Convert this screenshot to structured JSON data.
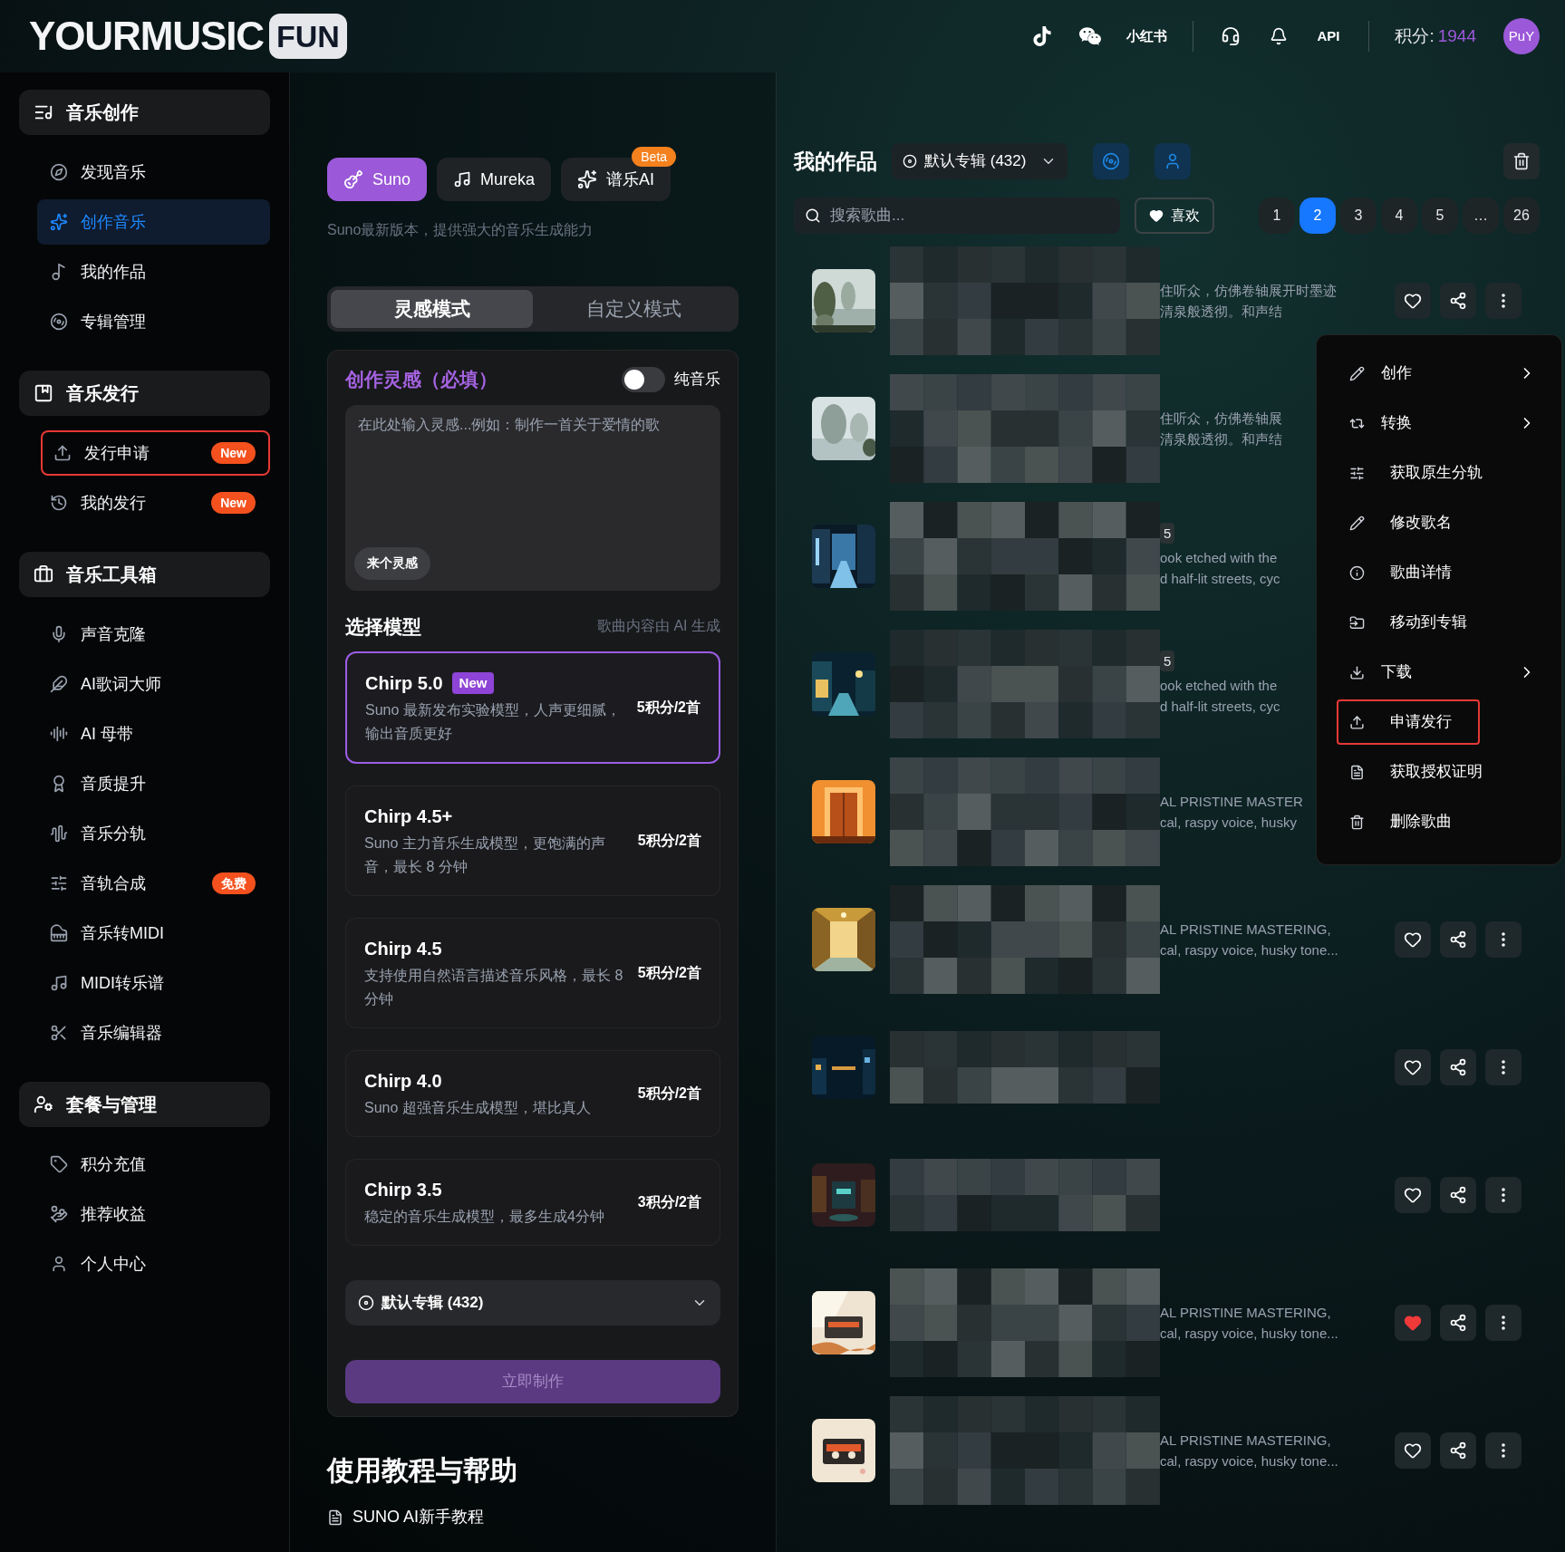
{
  "header": {
    "logo": "YOURMUSIC",
    "logo_badge": "FUN",
    "xiaohongshu": "小红书",
    "api": "API",
    "points_label": "积分:",
    "points": "1944",
    "avatar": "PuY"
  },
  "sidebar": {
    "sections": [
      {
        "title": "音乐创作",
        "items": [
          {
            "label": "发现音乐",
            "selected": false,
            "highlighted": false
          },
          {
            "label": "创作音乐",
            "selected": true,
            "highlighted": false
          },
          {
            "label": "我的作品",
            "selected": false,
            "highlighted": false
          },
          {
            "label": "专辑管理",
            "selected": false,
            "highlighted": false
          }
        ]
      },
      {
        "title": "音乐发行",
        "items": [
          {
            "label": "发行申请",
            "selected": false,
            "highlighted": true,
            "badge": "New"
          },
          {
            "label": "我的发行",
            "selected": false,
            "highlighted": false,
            "badge": "New"
          }
        ]
      },
      {
        "title": "音乐工具箱",
        "items": [
          {
            "label": "声音克隆",
            "selected": false,
            "highlighted": false
          },
          {
            "label": "AI歌词大师",
            "selected": false,
            "highlighted": false
          },
          {
            "label": "AI 母带",
            "selected": false,
            "highlighted": false
          },
          {
            "label": "音质提升",
            "selected": false,
            "highlighted": false
          },
          {
            "label": "音乐分轨",
            "selected": false,
            "highlighted": false
          },
          {
            "label": "音轨合成",
            "selected": false,
            "highlighted": false,
            "badge": "免费"
          },
          {
            "label": "音乐转MIDI",
            "selected": false,
            "highlighted": false
          },
          {
            "label": "MIDI转乐谱",
            "selected": false,
            "highlighted": false
          },
          {
            "label": "音乐编辑器",
            "selected": false,
            "highlighted": false
          }
        ]
      },
      {
        "title": "套餐与管理",
        "items": [
          {
            "label": "积分充值",
            "selected": false,
            "highlighted": false
          },
          {
            "label": "推荐收益",
            "selected": false,
            "highlighted": false
          },
          {
            "label": "个人中心",
            "selected": false,
            "highlighted": false
          }
        ]
      }
    ]
  },
  "create": {
    "engines": [
      {
        "label": "Suno",
        "selected": true
      },
      {
        "label": "Mureka",
        "selected": false
      },
      {
        "label": "谱乐AI",
        "selected": false,
        "badge": "Beta"
      }
    ],
    "engine_note": "Suno最新版本，提供强大的音乐生成能力",
    "modes": [
      {
        "label": "灵感模式",
        "selected": true
      },
      {
        "label": "自定义模式",
        "selected": false
      }
    ],
    "inspiration": {
      "title": "创作灵感（必填）",
      "instrumental_label": "纯音乐",
      "instrumental_on": false,
      "placeholder": "在此处输入灵感...例如：制作一首关于爱情的歌",
      "random_button": "来个灵感"
    },
    "model_title": "选择模型",
    "model_note": "歌曲内容由 AI 生成",
    "models": [
      {
        "name": "Chirp 5.0",
        "badge": "New",
        "description": "Suno 最新发布实验模型，人声更细腻，输出音质更好",
        "price": "5积分/2首",
        "selected": true
      },
      {
        "name": "Chirp 4.5+",
        "description": "Suno 主力音乐生成模型，更饱满的声音，最长 8 分钟",
        "price": "5积分/2首",
        "selected": false
      },
      {
        "name": "Chirp 4.5",
        "description": "支持使用自然语言描述音乐风格，最长 8 分钟",
        "price": "5积分/2首",
        "selected": false
      },
      {
        "name": "Chirp 4.0",
        "description": "Suno 超强音乐生成模型，堪比真人",
        "price": "5积分/2首",
        "selected": false
      },
      {
        "name": "Chirp 3.5",
        "description": "稳定的音乐生成模型，最多生成4分钟",
        "price": "3积分/2首",
        "selected": false
      }
    ],
    "album_select": "默认专辑 (432)",
    "create_button": "立即制作",
    "help": {
      "title": "使用教程与帮助",
      "links": [
        "SUNO AI新手教程"
      ]
    }
  },
  "works": {
    "title": "我的作品",
    "album": "默认专辑 (432)",
    "search_placeholder": "搜索歌曲...",
    "favorites_button": "喜欢",
    "pages": [
      {
        "label": "1",
        "selected": false
      },
      {
        "label": "2",
        "selected": true
      },
      {
        "label": "3",
        "selected": false
      },
      {
        "label": "4",
        "selected": false
      },
      {
        "label": "5",
        "selected": false
      },
      {
        "label": "…",
        "selected": false
      },
      {
        "label": "26",
        "selected": false
      }
    ],
    "songs": [
      {
        "lines": [
          "住听众，仿佛卷轴展开时墨迹",
          "清泉般透彻。和声结"
        ],
        "actions": {
          "liked": false
        }
      },
      {
        "lines": [
          "住听众，仿佛卷轴展",
          "清泉般透彻。和声结"
        ]
      },
      {
        "tag": "5",
        "lines": [
          "ook etched with the",
          "d half-lit streets, cyc"
        ]
      },
      {
        "tag": "5",
        "lines": [
          "ook etched with the",
          "d half-lit streets, cyc"
        ]
      },
      {
        "lines": [
          "AL PRISTINE MASTER",
          "cal, raspy voice, husky"
        ]
      },
      {
        "lines": [
          "AL PRISTINE MASTERING,",
          "cal, raspy voice, husky tone..."
        ],
        "actions": {
          "liked": false
        }
      },
      {
        "actions": {
          "liked": false
        }
      },
      {
        "actions": {
          "liked": false
        }
      },
      {
        "lines": [
          "AL PRISTINE MASTERING,",
          "cal, raspy voice, husky tone..."
        ],
        "actions": {
          "liked": true
        }
      },
      {
        "lines": [
          "AL PRISTINE MASTERING,",
          "cal, raspy voice, husky tone..."
        ],
        "actions": {
          "liked": false
        }
      }
    ],
    "menu": [
      {
        "label": "创作",
        "submenu": true,
        "highlighted": false
      },
      {
        "label": "转换",
        "submenu": true,
        "highlighted": false
      },
      {
        "label": "获取原生分轨",
        "submenu": false,
        "highlighted": false
      },
      {
        "label": "修改歌名",
        "submenu": false,
        "highlighted": false
      },
      {
        "label": "歌曲详情",
        "submenu": false,
        "highlighted": false
      },
      {
        "label": "移动到专辑",
        "submenu": false,
        "highlighted": false
      },
      {
        "label": "下载",
        "submenu": true,
        "highlighted": false
      },
      {
        "label": "申请发行",
        "submenu": false,
        "highlighted": true
      },
      {
        "label": "获取授权证明",
        "submenu": false,
        "highlighted": false
      },
      {
        "label": "删除歌曲",
        "submenu": false,
        "highlighted": false
      }
    ]
  }
}
